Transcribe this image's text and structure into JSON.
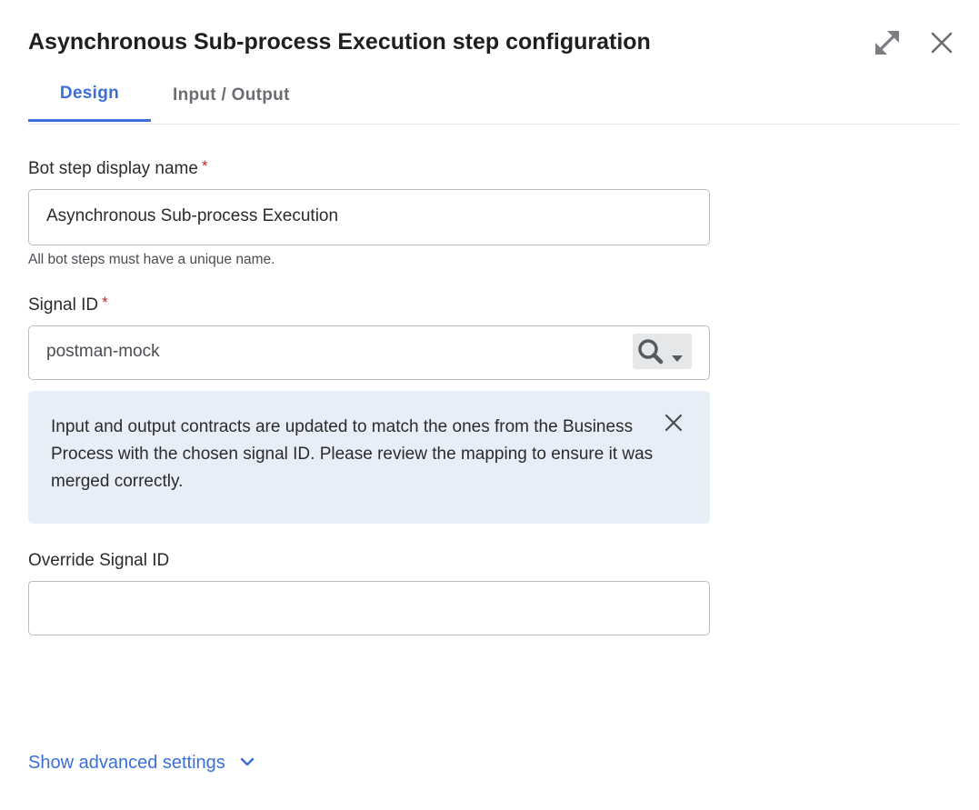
{
  "dialog": {
    "title": "Asynchronous Sub-process Execution step configuration",
    "expand_icon": "expand-diagonal-arrows-icon",
    "close_icon": "close-x-icon"
  },
  "tabs": [
    {
      "label": "Design",
      "active": true
    },
    {
      "label": "Input / Output",
      "active": false
    }
  ],
  "form": {
    "display_name": {
      "label": "Bot step display name",
      "required_mark": "*",
      "value": "Asynchronous Sub-process Execution",
      "helper": "All bot steps must have a unique name."
    },
    "signal_id": {
      "label": "Signal ID",
      "required_mark": "*",
      "value": "postman-mock",
      "lookup_icon": "search-icon",
      "dropdown_icon": "caret-down-icon"
    },
    "alert": {
      "message": "Input and output contracts are updated to match the ones from the Business Process with the chosen signal ID. Please review the mapping to ensure it was merged correctly.",
      "close_icon": "close-x-icon"
    },
    "override_signal_id": {
      "label": "Override Signal ID",
      "value": ""
    }
  },
  "footer": {
    "advanced_label": "Show advanced settings",
    "advanced_icon": "chevron-down-icon"
  },
  "colors": {
    "accent": "#3b6fd8",
    "required": "#c2272d",
    "alert_bg": "#e8eef8",
    "border": "#b9bcc1"
  }
}
